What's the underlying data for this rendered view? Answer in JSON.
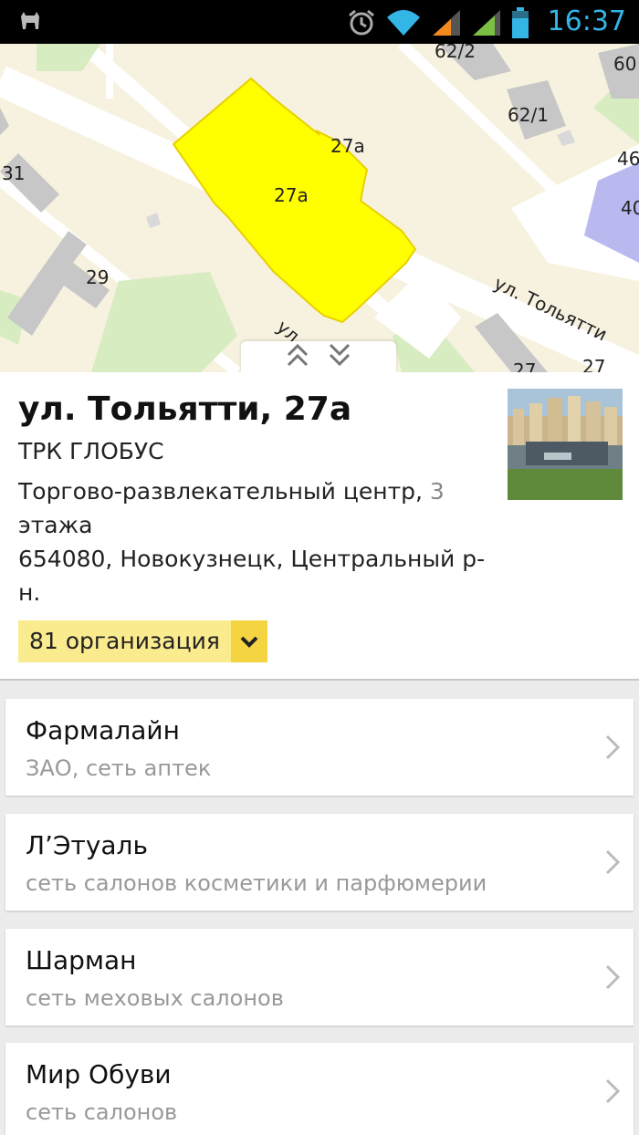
{
  "status_bar": {
    "time": "16:37",
    "icons": [
      "cat-app-icon",
      "alarm-icon",
      "wifi-icon",
      "signal-icon",
      "signal-icon",
      "battery-icon"
    ]
  },
  "map": {
    "labels": {
      "b62_2": "62/2",
      "b60": "60",
      "b62_1": "62/1",
      "b46": "46",
      "b40": "40",
      "b31": "31",
      "b27a_small": "27а",
      "b27a_main": "27а",
      "b29": "29",
      "street_main": "ул. Тольятти",
      "street_lower": "ул.",
      "b27_a": "27",
      "b27_b": "27"
    },
    "highlight_color": "#ffff00"
  },
  "info": {
    "title": "ул. Тольятти, 27а",
    "name": "ТРК ГЛОБУС",
    "desc_main": "Торгово-развлекательный центр, ",
    "desc_muted": "3",
    "desc_cont": " этажа",
    "address": "654080, Новокузнецк, Центральный р-н.",
    "organizations_label": "81 организация"
  },
  "list": [
    {
      "title": "Фармалайн",
      "subtitle": "ЗАО, сеть аптек"
    },
    {
      "title": "Л’Этуаль",
      "subtitle": "сеть салонов косметики и парфюмерии"
    },
    {
      "title": "Шарман",
      "subtitle": "сеть меховых салонов"
    },
    {
      "title": "Мир Обуви",
      "subtitle": "сеть салонов"
    }
  ],
  "colors": {
    "accent_time": "#33b5e5",
    "orgs_bg": "#fbeb8f",
    "orgs_button": "#f5d442"
  }
}
